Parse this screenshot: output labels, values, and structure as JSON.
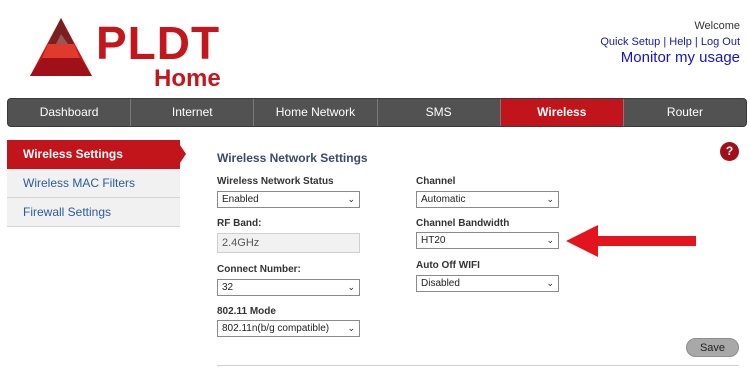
{
  "brand": {
    "logo_text": "PLDT",
    "logo_sub": "Home",
    "color": "#c4171d"
  },
  "header": {
    "welcome": "Welcome",
    "links": [
      "Quick Setup",
      "Help",
      "Log Out"
    ],
    "separator": " | ",
    "monitor": "Monitor my usage"
  },
  "nav": {
    "tabs": [
      {
        "label": "Dashboard"
      },
      {
        "label": "Internet"
      },
      {
        "label": "Home Network"
      },
      {
        "label": "SMS"
      },
      {
        "label": "Wireless",
        "active": true
      },
      {
        "label": "Router"
      }
    ],
    "active_color": "#c2141b"
  },
  "sidebar": {
    "items": [
      {
        "label": "Wireless Settings",
        "active": true
      },
      {
        "label": "Wireless MAC Filters"
      },
      {
        "label": "Firewall Settings"
      }
    ]
  },
  "main": {
    "title": "Wireless Network Settings",
    "help_icon": "?",
    "fields": {
      "network_status": {
        "label": "Wireless Network Status",
        "value": "Enabled"
      },
      "rf_band": {
        "label": "RF Band:",
        "value": "2.4GHz"
      },
      "connect_number": {
        "label": "Connect Number:",
        "value": "32"
      },
      "mode": {
        "label": "802.11 Mode",
        "value": "802.11n(b/g compatible)"
      },
      "channel": {
        "label": "Channel",
        "value": "Automatic"
      },
      "bandwidth": {
        "label": "Channel Bandwidth",
        "value": "HT20"
      },
      "auto_off": {
        "label": "Auto Off WIFI",
        "value": "Disabled"
      }
    },
    "save_label": "Save"
  },
  "icons": {
    "chevron": "chevron-down-icon",
    "annotation": "red-arrow-icon",
    "help": "question-icon"
  }
}
